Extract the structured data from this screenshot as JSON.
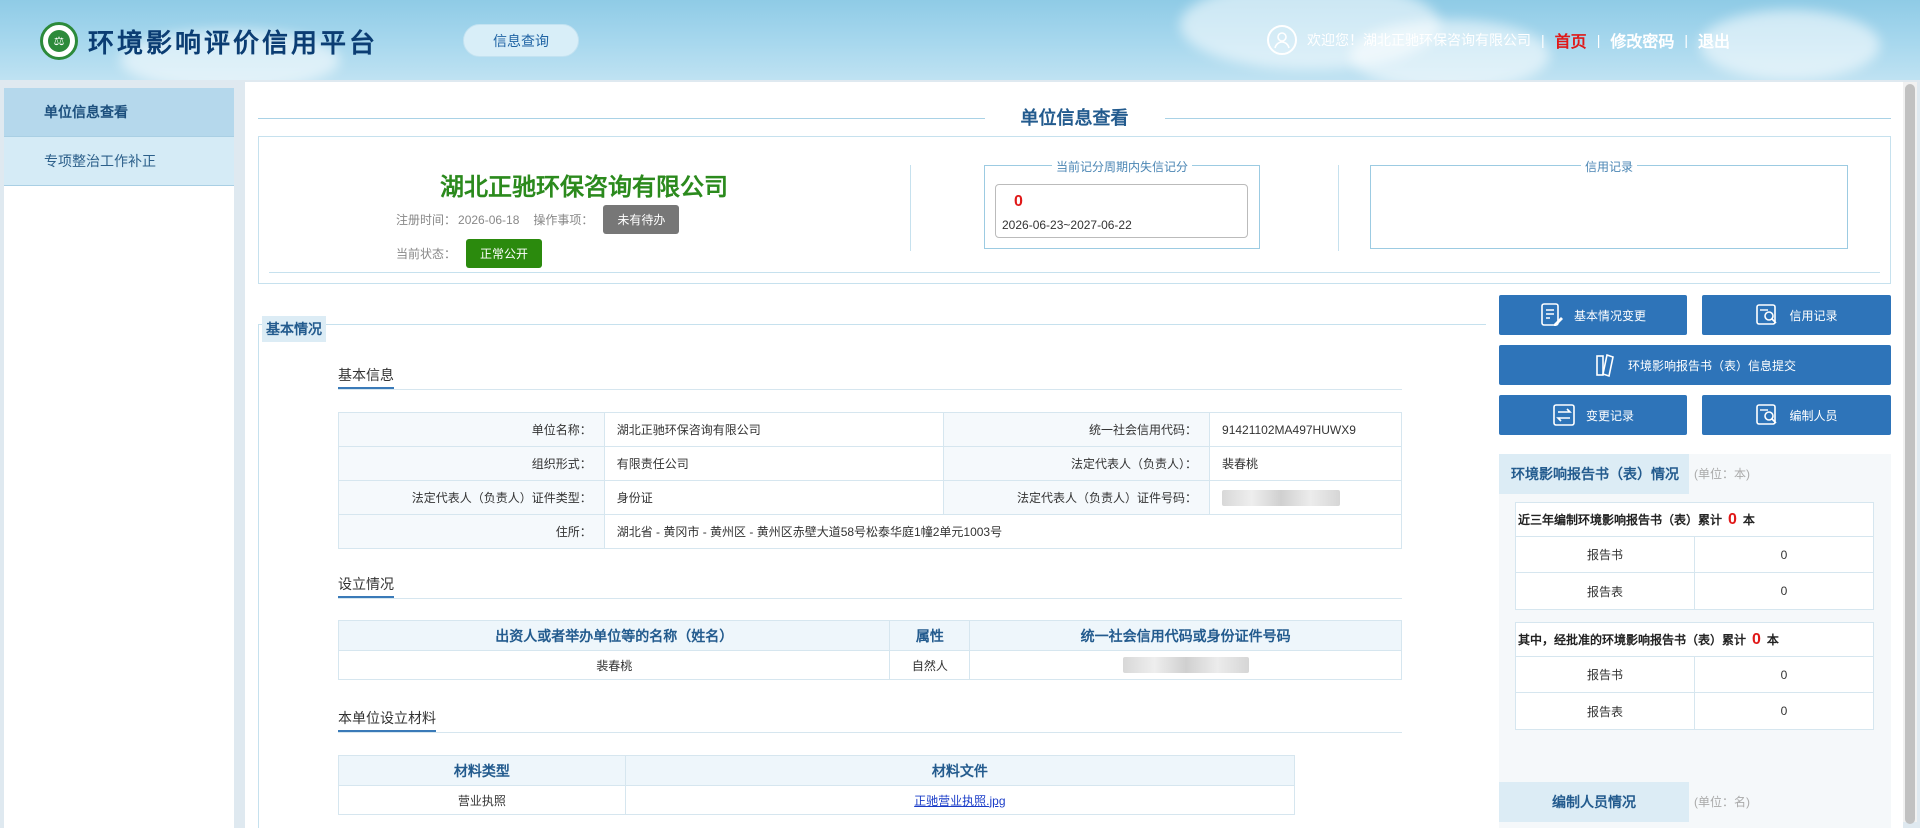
{
  "header": {
    "brand": "环境影响评价信用平台",
    "logo_icon": "emblem-icon",
    "query_button": "信息查询",
    "welcome": "欢迎您！湖北正驰环保咨询有限公司",
    "home": "首页",
    "change_password": "修改密码",
    "logout": "退出",
    "sep": "|"
  },
  "sidebar": {
    "items": [
      {
        "label": "单位信息查看",
        "active": true
      },
      {
        "label": "专项整治工作补正",
        "active": false
      }
    ]
  },
  "page": {
    "title": "单位信息查看"
  },
  "summary": {
    "company_name": "湖北正驰环保咨询有限公司",
    "reg_label": "注册时间：",
    "reg_date": "2026-06-18",
    "ops_label": "操作事项：",
    "ops_value": "未有待办",
    "status_label": "当前状态：",
    "status_value": "正常公开",
    "score_legend": "当前记分周期内失信记分",
    "score_value": "0",
    "score_period": "2026-06-23~2027-06-22",
    "credit_legend": "信用记录"
  },
  "basic": {
    "tag": "基本情况",
    "info_title": "基本信息",
    "info_rows": [
      {
        "l1": "单位名称：",
        "v1": "湖北正驰环保咨询有限公司",
        "l2": "统一社会信用代码：",
        "v2": "91421102MA497HUWX9"
      },
      {
        "l1": "组织形式：",
        "v1": "有限责任公司",
        "l2": "法定代表人（负责人）：",
        "v2": "裴春桃"
      },
      {
        "l1": "法定代表人（负责人）证件类型：",
        "v1": "身份证",
        "l2": "法定代表人（负责人）证件号码：",
        "v2": ""
      }
    ],
    "address_label": "住所：",
    "address_value": "湖北省 - 黄冈市 - 黄州区 - 黄州区赤壁大道58号松泰华庭1幢2单元1003号",
    "setup_title": "设立情况",
    "setup_headers": [
      "出资人或者举办单位等的名称（姓名）",
      "属性",
      "统一社会信用代码或身份证件号码"
    ],
    "setup_row": {
      "name": "裴春桃",
      "attr": "自然人"
    },
    "material_title": "本单位设立材料",
    "material_headers": [
      "材料类型",
      "材料文件"
    ],
    "material_row": {
      "type": "营业执照",
      "file": "正驰营业执照.jpg"
    }
  },
  "actions": {
    "basic_change": "基本情况变更",
    "credit_record": "信用记录",
    "report_submit": "环境影响报告书（表）信息提交",
    "change_record": "变更记录",
    "staff": "编制人员"
  },
  "report_panel": {
    "title": "环境影响报告书（表）情况",
    "unit": "(单位：本)",
    "box1_prefix": "近三年编制环境影响报告书（表）累计",
    "box1_count": "0",
    "box1_suffix": "本",
    "box2_prefix": "其中，经批准的环境影响报告书（表）累计",
    "box2_count": "0",
    "box2_suffix": "本",
    "rows": [
      {
        "name": "报告书",
        "value": "0"
      },
      {
        "name": "报告表",
        "value": "0"
      }
    ]
  },
  "staff_panel": {
    "title": "编制人员情况",
    "unit": "(单位：名)"
  },
  "colors": {
    "brand": "#0b3d73",
    "accent": "#2e74b9",
    "green": "#2b8a1d",
    "red": "#e01818"
  }
}
